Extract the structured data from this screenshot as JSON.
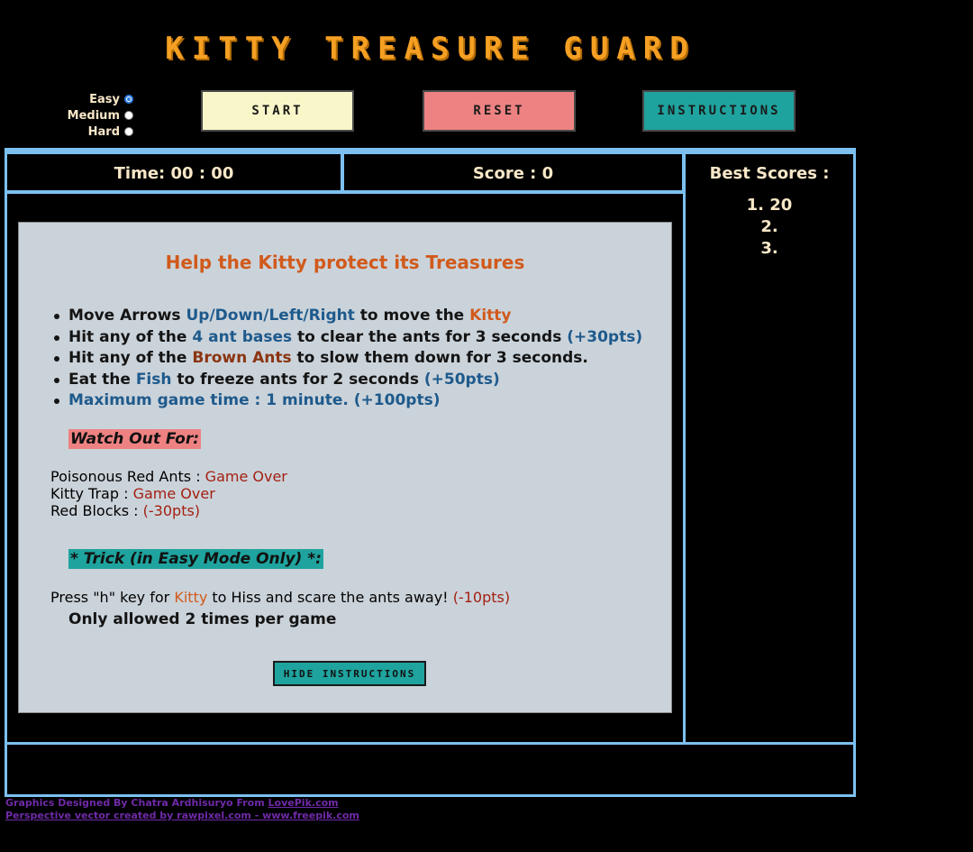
{
  "title": "KITTY TREASURE GUARD",
  "difficulty": {
    "options": [
      {
        "label": "Easy",
        "checked": true
      },
      {
        "label": "Medium",
        "checked": false
      },
      {
        "label": "Hard",
        "checked": false
      }
    ]
  },
  "buttons": {
    "start": "START",
    "reset": "RESET",
    "instructions": "INSTRUCTIONS"
  },
  "stats": {
    "time": "Time: 00 : 00",
    "score": "Score : 0"
  },
  "best_scores": {
    "label": "Best Scores :",
    "entries": [
      "1. 20",
      "2.",
      "3."
    ]
  },
  "instructions": {
    "heading": "Help the Kitty protect its Treasures",
    "rules": [
      [
        {
          "t": "Move Arrows "
        },
        {
          "t": "Up/Down/Left/Right",
          "c": "blue"
        },
        {
          "t": " to move the "
        },
        {
          "t": "Kitty",
          "c": "orange"
        }
      ],
      [
        {
          "t": "Hit any of the "
        },
        {
          "t": "4 ant bases",
          "c": "blue"
        },
        {
          "t": " to clear the ants for 3 seconds "
        },
        {
          "t": "(+30pts)",
          "c": "blue"
        }
      ],
      [
        {
          "t": "Hit any of the "
        },
        {
          "t": "Brown Ants",
          "c": "brown"
        },
        {
          "t": " to slow them down for 3 seconds."
        }
      ],
      [
        {
          "t": "Eat the "
        },
        {
          "t": "Fish",
          "c": "blue"
        },
        {
          "t": " to freeze ants for 2 seconds "
        },
        {
          "t": "(+50pts)",
          "c": "blue"
        }
      ],
      [
        {
          "t": "Maximum game time : 1 minute. (+100pts)",
          "c": "blue"
        }
      ]
    ],
    "watch_out_heading": "Watch Out For:",
    "dangers": [
      [
        {
          "t": "Poisonous Red Ants : "
        },
        {
          "t": "Game Over",
          "c": "red"
        }
      ],
      [
        {
          "t": "Kitty Trap : "
        },
        {
          "t": "Game Over",
          "c": "red"
        }
      ],
      [
        {
          "t": "Red Blocks : "
        },
        {
          "t": "(-30pts)",
          "c": "red"
        }
      ]
    ],
    "trick_heading": "* Trick (in Easy Mode Only) *:",
    "trick": [
      [
        {
          "t": "Press \"h\" key for "
        },
        {
          "t": "Kitty",
          "c": "orange"
        },
        {
          "t": " to Hiss and scare the ants away! "
        },
        {
          "t": "(-10pts)",
          "c": "red"
        }
      ]
    ],
    "trick_note": "Only allowed 2 times per game",
    "hide_button": "HIDE INSTRUCTIONS"
  },
  "credits": {
    "line1_text": "Graphics Designed By Chatra Ardhisuryo From ",
    "line1_link": "LovePik.com",
    "line2_link": "Perspective vector created by rawpixel.com - www.freepik.com"
  },
  "colors": {
    "title": "#f5a023",
    "frame": "#7cc0f0",
    "start_bg": "#f9f7c9",
    "reset_bg": "#ee8282",
    "instructions_bg": "#1fa39e",
    "panel_bg": "#cbd3da"
  }
}
